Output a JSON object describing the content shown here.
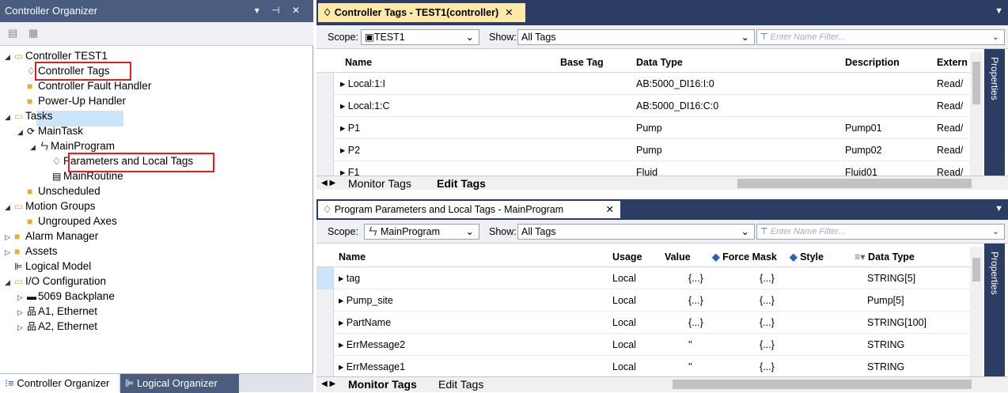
{
  "organizer": {
    "title": "Controller Organizer",
    "title_buttons": "▾ ⊣ ✕",
    "tree": [
      {
        "label": "Controller TEST1",
        "arrow": "◢",
        "icon": "folder-open-icon"
      },
      {
        "label": "Controller Tags",
        "arrow": "",
        "icon": "tag-icon"
      },
      {
        "label": "Controller Fault Handler",
        "arrow": "",
        "icon": "folder-icon"
      },
      {
        "label": "Power-Up Handler",
        "arrow": "",
        "icon": "folder-icon"
      },
      {
        "label": "Tasks",
        "arrow": "◢",
        "icon": "folder-open-icon"
      },
      {
        "label": "MainTask",
        "arrow": "◢",
        "icon": "task-icon"
      },
      {
        "label": "MainProgram",
        "arrow": "◢",
        "icon": "program-icon"
      },
      {
        "label": "Parameters and Local Tags",
        "arrow": "",
        "icon": "tag-icon"
      },
      {
        "label": "MainRoutine",
        "arrow": "",
        "icon": "routine-icon"
      },
      {
        "label": "Unscheduled",
        "arrow": "",
        "icon": "folder-icon"
      },
      {
        "label": "Motion Groups",
        "arrow": "◢",
        "icon": "folder-open-icon"
      },
      {
        "label": "Ungrouped Axes",
        "arrow": "",
        "icon": "folder-icon"
      },
      {
        "label": "Alarm Manager",
        "arrow": "▷",
        "icon": "folder-icon"
      },
      {
        "label": "Assets",
        "arrow": "▷",
        "icon": "folder-icon"
      },
      {
        "label": "Logical Model",
        "arrow": "",
        "icon": "logical-model-icon"
      },
      {
        "label": "I/O Configuration",
        "arrow": "◢",
        "icon": "folder-open-icon"
      },
      {
        "label": "5069 Backplane",
        "arrow": "▷",
        "icon": "backplane-icon"
      },
      {
        "label": "A1, Ethernet",
        "arrow": "▷",
        "icon": "network-icon"
      },
      {
        "label": "A2, Ethernet",
        "arrow": "▷",
        "icon": "network-icon"
      }
    ],
    "tabs": [
      "Controller Organizer",
      "Logical Organizer"
    ]
  },
  "pane1": {
    "tab": "Controller Tags - TEST1(controller)",
    "scope_label": "Scope:",
    "scope_value": "TEST1",
    "show_label": "Show:",
    "show_value": "All Tags",
    "filter_placeholder": "Enter Name Filter...",
    "headers": [
      "Name",
      "Base Tag",
      "Data Type",
      "Description",
      "Extern"
    ],
    "rows": [
      {
        "name": "Local:1:I",
        "base": "",
        "type": "AB:5000_DI16:I:0",
        "desc": "",
        "ext": "Read/"
      },
      {
        "name": "Local:1:C",
        "base": "",
        "type": "AB:5000_DI16:C:0",
        "desc": "",
        "ext": "Read/"
      },
      {
        "name": "P1",
        "base": "",
        "type": "Pump",
        "desc": "Pump01",
        "ext": "Read/"
      },
      {
        "name": "P2",
        "base": "",
        "type": "Pump",
        "desc": "Pump02",
        "ext": "Read/"
      },
      {
        "name": "F1",
        "base": "",
        "type": "Fluid",
        "desc": "Fluid01",
        "ext": "Read/"
      }
    ],
    "bottom_tabs": [
      "Monitor Tags",
      "Edit Tags"
    ],
    "side_label": "Properties"
  },
  "pane2": {
    "tab": "Program Parameters and Local Tags - MainProgram",
    "scope_label": "Scope:",
    "scope_value": "MainProgram",
    "show_label": "Show:",
    "show_value": "All Tags",
    "filter_placeholder": "Enter Name Filter...",
    "headers": [
      "Name",
      "Usage",
      "Value",
      "Force Mask",
      "Style",
      "Data Type"
    ],
    "rows": [
      {
        "name": "tag",
        "usage": "Local",
        "value": "{...}",
        "force": "{...}",
        "style": "",
        "type": "STRING[5]"
      },
      {
        "name": "Pump_site",
        "usage": "Local",
        "value": "{...}",
        "force": "{...}",
        "style": "",
        "type": "Pump[5]"
      },
      {
        "name": "PartName",
        "usage": "Local",
        "value": "{...}",
        "force": "{...}",
        "style": "",
        "type": "STRING[100]"
      },
      {
        "name": "ErrMessage2",
        "usage": "Local",
        "value": "''",
        "force": "{...}",
        "style": "",
        "type": "STRING"
      },
      {
        "name": "ErrMessage1",
        "usage": "Local",
        "value": "''",
        "force": "{...}",
        "style": "",
        "type": "STRING"
      }
    ],
    "bottom_tabs": [
      "Monitor Tags",
      "Edit Tags"
    ],
    "side_label": "Properties"
  },
  "colors": {
    "titlebar": "#4a5d7e",
    "docbar": "#2b3d63",
    "active_tab": "#ffe9a8",
    "selection": "#cce4f7",
    "highlight": "#e02020"
  }
}
